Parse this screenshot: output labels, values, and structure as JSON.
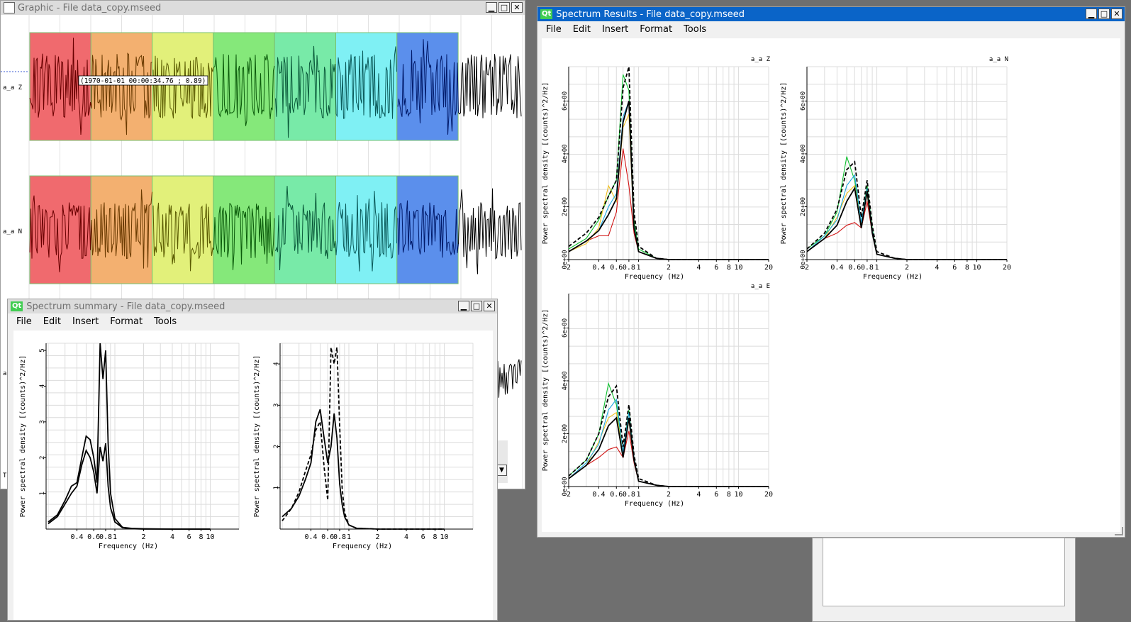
{
  "graphic_window": {
    "title": "Graphic - File data_copy.mseed",
    "channels": [
      "a_a Z",
      "a_a N",
      "a",
      "T"
    ],
    "cursor_tooltip": "(1970-01-01 00:00:34.76 ; 0.89)",
    "window_colors": [
      "#f06a6e",
      "#f3b070",
      "#e2f07a",
      "#85e87a",
      "#78eaa8",
      "#7ff0f4",
      "#5b8fec"
    ]
  },
  "summary_window": {
    "title": "Spectrum summary - File data_copy.mseed",
    "menu": [
      "File",
      "Edit",
      "Insert",
      "Format",
      "Tools"
    ]
  },
  "results_window": {
    "title": "Spectrum Results - File data_copy.mseed",
    "menu": [
      "File",
      "Edit",
      "Insert",
      "Format",
      "Tools"
    ]
  },
  "window_buttons": {
    "minimize": "▁",
    "maximize": "□",
    "close": "✕"
  },
  "chart_data": [
    {
      "type": "line",
      "panel": "summary-left",
      "xlabel": "Frequency (Hz)",
      "ylabel": "Power spectral density [(counts)^2/Hz]",
      "x_scale": "log",
      "xticks": [
        "0.4",
        "0.6",
        "0.8",
        "1",
        "2",
        "4",
        "6",
        "8",
        "10"
      ],
      "yticks": [
        "1",
        "2",
        "3",
        "4",
        "5"
      ],
      "ylim": [
        0,
        5.2
      ],
      "series": [
        {
          "style": "solid",
          "x": [
            0.2,
            0.25,
            0.3,
            0.35,
            0.4,
            0.45,
            0.5,
            0.55,
            0.6,
            0.65,
            0.7,
            0.75,
            0.8,
            0.85,
            0.9,
            1.0,
            1.2,
            1.5,
            2,
            4,
            10
          ],
          "y": [
            0.2,
            0.4,
            0.8,
            1.2,
            1.3,
            2.0,
            2.6,
            2.5,
            2.0,
            1.3,
            5.2,
            4.2,
            5.0,
            2.4,
            1.0,
            0.3,
            0.05,
            0.02,
            0.01,
            0,
            0
          ]
        },
        {
          "style": "solid",
          "x": [
            0.2,
            0.25,
            0.3,
            0.35,
            0.4,
            0.45,
            0.5,
            0.55,
            0.6,
            0.65,
            0.7,
            0.75,
            0.8,
            0.85,
            0.9,
            1.0,
            1.2,
            1.5,
            2,
            4,
            10
          ],
          "y": [
            0.15,
            0.35,
            0.7,
            1.0,
            1.2,
            1.8,
            2.2,
            2.0,
            1.6,
            1.0,
            2.3,
            1.9,
            2.4,
            1.2,
            0.6,
            0.2,
            0.04,
            0.01,
            0,
            0,
            0
          ]
        }
      ]
    },
    {
      "type": "line",
      "panel": "summary-right",
      "xlabel": "Frequency (Hz)",
      "ylabel": "Power spectral density [(counts)^2/Hz]",
      "x_scale": "log",
      "xticks": [
        "0.4",
        "0.6",
        "0.8",
        "1",
        "2",
        "4",
        "6",
        "8",
        "10"
      ],
      "yticks": [
        "1",
        "2",
        "3",
        "4"
      ],
      "ylim": [
        0,
        4.5
      ],
      "series": [
        {
          "style": "solid",
          "x": [
            0.2,
            0.25,
            0.3,
            0.35,
            0.4,
            0.45,
            0.5,
            0.55,
            0.6,
            0.65,
            0.7,
            0.75,
            0.8,
            0.85,
            0.9,
            1.0,
            1.2,
            2,
            10
          ],
          "y": [
            0.3,
            0.5,
            0.8,
            1.2,
            1.6,
            2.6,
            2.9,
            2.2,
            1.6,
            2.0,
            2.8,
            2.2,
            1.1,
            0.6,
            0.3,
            0.1,
            0.02,
            0,
            0
          ]
        },
        {
          "style": "dashed",
          "x": [
            0.2,
            0.25,
            0.3,
            0.35,
            0.4,
            0.45,
            0.5,
            0.55,
            0.6,
            0.65,
            0.7,
            0.75,
            0.8,
            0.85,
            0.9,
            1.0,
            1.2,
            2,
            10
          ],
          "y": [
            0.2,
            0.5,
            0.9,
            1.4,
            1.8,
            2.4,
            2.6,
            1.5,
            0.7,
            4.4,
            4.0,
            4.4,
            2.5,
            1.0,
            0.4,
            0.1,
            0.02,
            0,
            0
          ]
        }
      ]
    },
    {
      "type": "line",
      "panel": "results-Z",
      "label": "a_a Z",
      "xlabel": "Frequency (Hz)",
      "ylabel": "Power spectral density [(counts)^2/Hz]",
      "x_scale": "log",
      "xticks": [
        "2",
        "0.4",
        "0.6",
        "0.8",
        "1",
        "2",
        "4",
        "6",
        "8",
        "10",
        "20"
      ],
      "yticks": [
        "0e+00",
        "2e+00",
        "4e+00",
        "6e+00"
      ],
      "ylim": [
        0,
        7.3
      ],
      "series": [
        {
          "color": "#d01010",
          "style": "solid",
          "x": [
            0.2,
            0.3,
            0.4,
            0.5,
            0.6,
            0.7,
            0.8,
            0.9,
            1.0,
            1.5,
            2,
            4,
            10,
            20
          ],
          "y": [
            0.3,
            0.7,
            0.9,
            0.9,
            1.8,
            4.2,
            2.8,
            1.0,
            0.3,
            0.05,
            0,
            0,
            0,
            0
          ]
        },
        {
          "color": "#10c030",
          "style": "solid",
          "x": [
            0.2,
            0.3,
            0.4,
            0.5,
            0.6,
            0.7,
            0.8,
            0.9,
            1.0,
            1.5,
            2,
            4,
            10,
            20
          ],
          "y": [
            0.4,
            0.8,
            1.5,
            2.4,
            3.0,
            7.0,
            6.4,
            1.5,
            0.4,
            0.05,
            0,
            0,
            0,
            0
          ]
        },
        {
          "color": "#f0c020",
          "style": "solid",
          "x": [
            0.2,
            0.3,
            0.4,
            0.5,
            0.6,
            0.7,
            0.8,
            0.9,
            1.0,
            1.5,
            2,
            4,
            10,
            20
          ],
          "y": [
            0.3,
            0.6,
            1.2,
            2.8,
            2.2,
            5.0,
            5.5,
            1.2,
            0.3,
            0.05,
            0,
            0,
            0,
            0
          ]
        },
        {
          "color": "#20a8e0",
          "style": "solid",
          "x": [
            0.2,
            0.3,
            0.4,
            0.5,
            0.6,
            0.7,
            0.8,
            0.9,
            1.0,
            1.5,
            2,
            4,
            10,
            20
          ],
          "y": [
            0.3,
            0.7,
            1.1,
            2.0,
            2.5,
            5.4,
            6.0,
            1.3,
            0.3,
            0.05,
            0,
            0,
            0,
            0
          ]
        },
        {
          "color": "#000000",
          "style": "solid",
          "x": [
            0.2,
            0.3,
            0.4,
            0.5,
            0.6,
            0.7,
            0.8,
            0.9,
            1.0,
            1.5,
            2,
            4,
            10,
            20
          ],
          "y": [
            0.3,
            0.7,
            1.1,
            1.7,
            2.3,
            5.2,
            6.0,
            1.2,
            0.3,
            0.05,
            0,
            0,
            0,
            0
          ]
        },
        {
          "color": "#000000",
          "style": "dashed",
          "x": [
            0.2,
            0.3,
            0.4,
            0.5,
            0.6,
            0.7,
            0.8,
            0.9,
            1.0,
            1.5,
            2,
            4,
            10,
            20
          ],
          "y": [
            0.5,
            1.0,
            1.6,
            2.4,
            3.0,
            6.5,
            7.3,
            1.8,
            0.5,
            0.05,
            0,
            0,
            0,
            0
          ]
        }
      ]
    },
    {
      "type": "line",
      "panel": "results-N",
      "label": "a_a N",
      "xlabel": "Frequency (Hz)",
      "ylabel": "Power spectral density [(counts)^2/Hz]",
      "x_scale": "log",
      "xticks": [
        "2",
        "0.4",
        "0.6",
        "0.8",
        "1",
        "2",
        "4",
        "6",
        "8",
        "10",
        "20"
      ],
      "yticks": [
        "0e+00",
        "2e+00",
        "4e+00",
        "6e+00"
      ],
      "ylim": [
        0,
        7.3
      ],
      "series": [
        {
          "color": "#d01010",
          "style": "solid",
          "x": [
            0.2,
            0.3,
            0.4,
            0.5,
            0.6,
            0.7,
            0.8,
            0.9,
            1.0,
            1.5,
            2,
            4,
            10,
            20
          ],
          "y": [
            0.3,
            0.8,
            1.0,
            1.3,
            1.4,
            1.2,
            2.2,
            1.0,
            0.2,
            0.05,
            0,
            0,
            0,
            0
          ]
        },
        {
          "color": "#10c030",
          "style": "solid",
          "x": [
            0.2,
            0.3,
            0.4,
            0.5,
            0.6,
            0.7,
            0.8,
            0.9,
            1.0,
            1.5,
            2,
            4,
            10,
            20
          ],
          "y": [
            0.4,
            0.9,
            1.8,
            3.9,
            3.0,
            1.4,
            2.8,
            1.2,
            0.2,
            0.05,
            0,
            0,
            0,
            0
          ]
        },
        {
          "color": "#f0c020",
          "style": "solid",
          "x": [
            0.2,
            0.3,
            0.4,
            0.5,
            0.6,
            0.7,
            0.8,
            0.9,
            1.0,
            1.5,
            2,
            4,
            10,
            20
          ],
          "y": [
            0.3,
            0.8,
            1.6,
            2.5,
            2.8,
            1.3,
            2.5,
            1.0,
            0.2,
            0.05,
            0,
            0,
            0,
            0
          ]
        },
        {
          "color": "#20a8e0",
          "style": "solid",
          "x": [
            0.2,
            0.3,
            0.4,
            0.5,
            0.6,
            0.7,
            0.8,
            0.9,
            1.0,
            1.5,
            2,
            4,
            10,
            20
          ],
          "y": [
            0.3,
            0.9,
            1.5,
            2.8,
            3.2,
            1.4,
            2.7,
            1.1,
            0.2,
            0.05,
            0,
            0,
            0,
            0
          ]
        },
        {
          "color": "#000000",
          "style": "solid",
          "x": [
            0.2,
            0.3,
            0.4,
            0.5,
            0.6,
            0.7,
            0.8,
            0.9,
            1.0,
            1.5,
            2,
            4,
            10,
            20
          ],
          "y": [
            0.3,
            0.8,
            1.3,
            2.2,
            2.7,
            1.2,
            2.6,
            1.0,
            0.2,
            0.05,
            0,
            0,
            0,
            0
          ]
        },
        {
          "color": "#000000",
          "style": "dashed",
          "x": [
            0.2,
            0.3,
            0.4,
            0.5,
            0.6,
            0.7,
            0.8,
            0.9,
            1.0,
            1.5,
            2,
            4,
            10,
            20
          ],
          "y": [
            0.4,
            1.0,
            1.9,
            3.4,
            3.7,
            1.6,
            3.0,
            1.3,
            0.3,
            0.05,
            0,
            0,
            0,
            0
          ]
        }
      ]
    },
    {
      "type": "line",
      "panel": "results-E",
      "label": "a_a E",
      "xlabel": "Frequency (Hz)",
      "ylabel": "Power spectral density [(counts)^2/Hz]",
      "x_scale": "log",
      "xticks": [
        "2",
        "0.4",
        "0.6",
        "0.8",
        "1",
        "2",
        "4",
        "6",
        "8",
        "10",
        "20"
      ],
      "yticks": [
        "0e+00",
        "2e+00",
        "4e+00",
        "6e+00"
      ],
      "ylim": [
        0,
        7.3
      ],
      "series": [
        {
          "color": "#d01010",
          "style": "solid",
          "x": [
            0.2,
            0.3,
            0.4,
            0.5,
            0.6,
            0.7,
            0.8,
            0.9,
            1.0,
            1.5,
            2,
            4,
            10,
            20
          ],
          "y": [
            0.3,
            0.8,
            1.1,
            1.4,
            1.5,
            1.1,
            2.1,
            0.9,
            0.2,
            0.05,
            0,
            0,
            0,
            0
          ]
        },
        {
          "color": "#10c030",
          "style": "solid",
          "x": [
            0.2,
            0.3,
            0.4,
            0.5,
            0.6,
            0.7,
            0.8,
            0.9,
            1.0,
            1.5,
            2,
            4,
            10,
            20
          ],
          "y": [
            0.4,
            1.0,
            2.0,
            3.9,
            3.1,
            1.3,
            2.9,
            1.1,
            0.2,
            0.05,
            0,
            0,
            0,
            0
          ]
        },
        {
          "color": "#f0c020",
          "style": "solid",
          "x": [
            0.2,
            0.3,
            0.4,
            0.5,
            0.6,
            0.7,
            0.8,
            0.9,
            1.0,
            1.5,
            2,
            4,
            10,
            20
          ],
          "y": [
            0.3,
            0.8,
            1.7,
            2.6,
            2.8,
            1.2,
            2.5,
            1.0,
            0.2,
            0.05,
            0,
            0,
            0,
            0
          ]
        },
        {
          "color": "#20a8e0",
          "style": "solid",
          "x": [
            0.2,
            0.3,
            0.4,
            0.5,
            0.6,
            0.7,
            0.8,
            0.9,
            1.0,
            1.5,
            2,
            4,
            10,
            20
          ],
          "y": [
            0.3,
            0.9,
            1.6,
            2.9,
            3.3,
            1.3,
            2.8,
            1.1,
            0.2,
            0.05,
            0,
            0,
            0,
            0
          ]
        },
        {
          "color": "#000000",
          "style": "solid",
          "x": [
            0.2,
            0.3,
            0.4,
            0.5,
            0.6,
            0.7,
            0.8,
            0.9,
            1.0,
            1.5,
            2,
            4,
            10,
            20
          ],
          "y": [
            0.3,
            0.8,
            1.4,
            2.3,
            2.6,
            1.1,
            2.6,
            1.0,
            0.2,
            0.05,
            0,
            0,
            0,
            0
          ]
        },
        {
          "color": "#000000",
          "style": "dashed",
          "x": [
            0.2,
            0.3,
            0.4,
            0.5,
            0.6,
            0.7,
            0.8,
            0.9,
            1.0,
            1.5,
            2,
            4,
            10,
            20
          ],
          "y": [
            0.4,
            1.0,
            2.0,
            3.4,
            3.8,
            1.5,
            3.1,
            1.2,
            0.3,
            0.05,
            0,
            0,
            0,
            0
          ]
        }
      ]
    }
  ]
}
